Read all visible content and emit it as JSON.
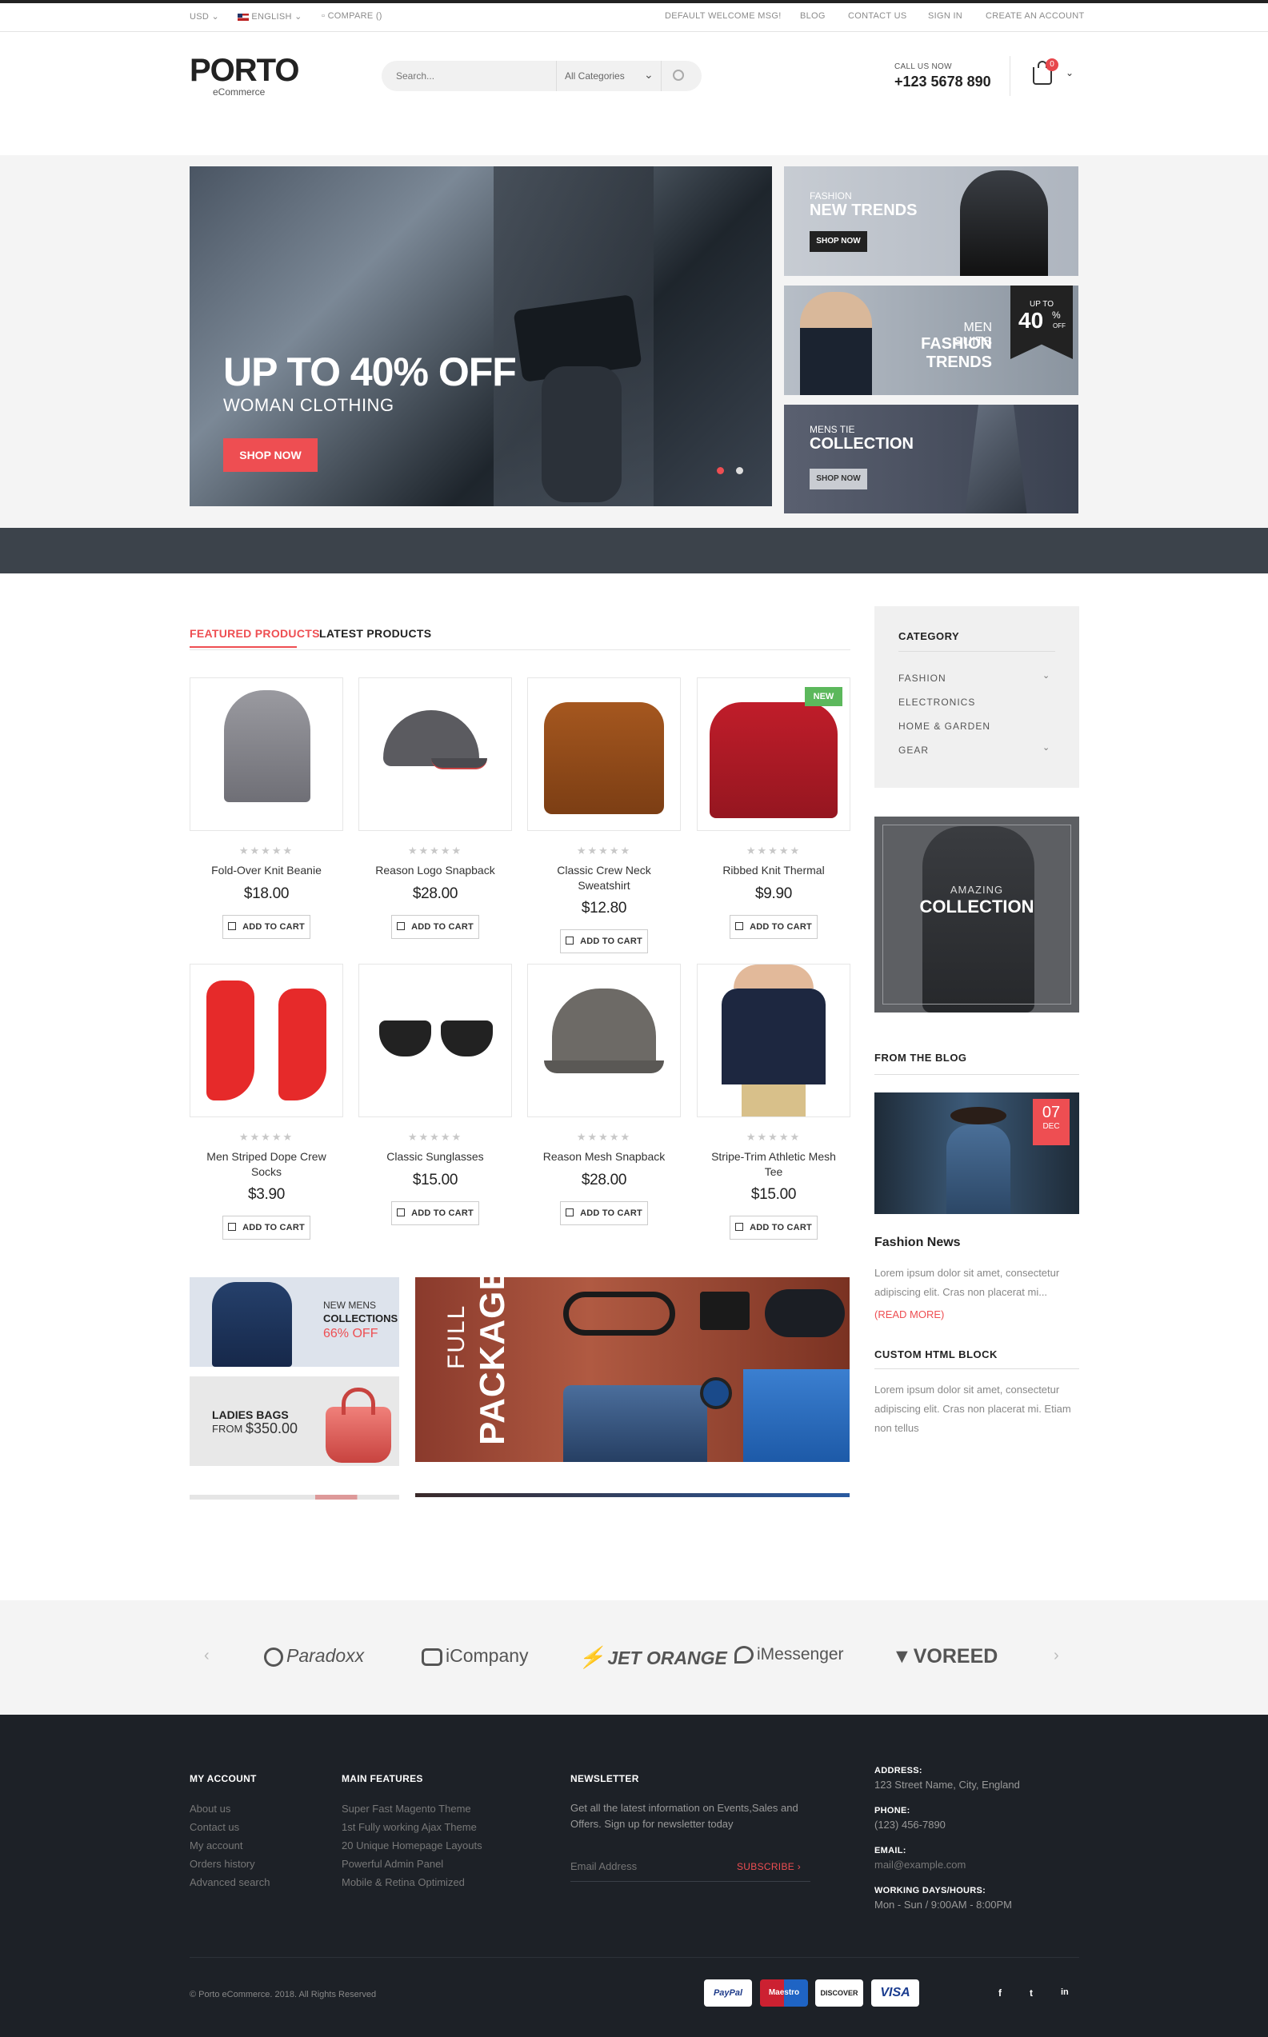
{
  "topbar": {
    "currency": "USD",
    "language": "ENGLISH",
    "compare": "COMPARE ()",
    "links": [
      "DEFAULT WELCOME MSG!",
      "BLOG",
      "CONTACT US",
      "SIGN IN",
      "CREATE AN ACCOUNT"
    ]
  },
  "header": {
    "logo": "PORTO",
    "logo_sub": "eCommerce",
    "search_placeholder": "Search...",
    "category_select": "All Categories",
    "call_label": "CALL US NOW",
    "phone": "+123 5678 890",
    "cart_count": "0"
  },
  "hero": {
    "main": {
      "headline": "UP TO 40% OFF",
      "sub": "WOMAN CLOTHING",
      "button": "SHOP NOW"
    },
    "banner1": {
      "small": "FASHION",
      "big": "NEW TRENDS",
      "button": "SHOP NOW"
    },
    "banner2": {
      "small": "MEN SUITS",
      "big": "FASHION TRENDS",
      "upto": "UP TO",
      "pct": "40",
      "pct_sign": "%",
      "off": "OFF"
    },
    "banner3": {
      "small": "MENS TIE",
      "big": "COLLECTION",
      "button": "SHOP NOW"
    }
  },
  "tabs": [
    "FEATURED PRODUCTS",
    "LATEST PRODUCTS"
  ],
  "products": [
    {
      "name": "Fold-Over Knit Beanie",
      "price": "$18.00",
      "badge": ""
    },
    {
      "name": "Reason Logo Snapback",
      "price": "$28.00",
      "badge": ""
    },
    {
      "name": "Classic Crew Neck Sweatshirt",
      "price": "$12.80",
      "badge": ""
    },
    {
      "name": "Ribbed Knit Thermal",
      "price": "$9.90",
      "badge": "NEW"
    },
    {
      "name": "Men Striped Dope Crew Socks",
      "price": "$3.90",
      "badge": ""
    },
    {
      "name": "Classic Sunglasses",
      "price": "$15.00",
      "badge": ""
    },
    {
      "name": "Reason Mesh Snapback",
      "price": "$28.00",
      "badge": ""
    },
    {
      "name": "Stripe-Trim Athletic Mesh Tee",
      "price": "$15.00",
      "badge": ""
    }
  ],
  "add_to_cart": "ADD TO CART",
  "stars": "★★★★★",
  "promo": {
    "mens": {
      "small": "NEW MENS",
      "big": "COLLECTIONS",
      "off": "66% OFF"
    },
    "bags": {
      "title": "LADIES BAGS",
      "from": "FROM",
      "price": "$350.00"
    },
    "package": {
      "light": "FULL",
      "bold": "PACKAGE"
    }
  },
  "sidebar": {
    "category_title": "CATEGORY",
    "categories": [
      "FASHION",
      "ELECTRONICS",
      "HOME & GARDEN",
      "GEAR"
    ],
    "amazing_small": "AMAZING",
    "amazing_big": "COLLECTION",
    "blog_title": "FROM THE BLOG",
    "blog_day": "07",
    "blog_month": "DEC",
    "post_title": "Fashion News",
    "post_excerpt": "Lorem ipsum dolor sit amet, consectetur adipiscing elit. Cras non placerat mi...",
    "read_more": "(READ MORE)",
    "html_title": "CUSTOM HTML BLOCK",
    "html_text": "Lorem ipsum dolor sit amet, consectetur adipiscing elit. Cras non placerat mi. Etiam non tellus"
  },
  "brands": [
    "Paradoxx",
    "iCompany",
    "JET ORANGE",
    "iMessenger",
    "VOREED"
  ],
  "footer": {
    "account_title": "MY ACCOUNT",
    "account_links": [
      "About us",
      "Contact us",
      "My account",
      "Orders history",
      "Advanced search"
    ],
    "features_title": "MAIN FEATURES",
    "features_links": [
      "Super Fast Magento Theme",
      "1st Fully working Ajax Theme",
      "20 Unique Homepage Layouts",
      "Powerful Admin Panel",
      "Mobile & Retina Optimized"
    ],
    "newsletter_title": "NEWSLETTER",
    "newsletter_text": "Get all the latest information on Events,Sales and Offers. Sign up for newsletter today",
    "email_placeholder": "Email Address",
    "subscribe": "SUBSCRIBE",
    "address_label": "ADDRESS:",
    "address": "123 Street Name, City, England",
    "phone_label": "PHONE:",
    "phone": "(123) 456-7890",
    "email_label": "EMAIL:",
    "email": "mail@example.com",
    "hours_label": "WORKING DAYS/HOURS:",
    "hours": "Mon - Sun / 9:00AM - 8:00PM",
    "copyright": "© Porto eCommerce. 2018. All Rights Reserved",
    "payments": [
      "PayPal",
      "Maestro",
      "DISCOVER",
      "VISA"
    ],
    "social": [
      "f",
      "t",
      "in"
    ]
  },
  "colors": {
    "accent": "#ee4e52",
    "dark": "#1d2127",
    "new_badge": "#5cb85c"
  }
}
